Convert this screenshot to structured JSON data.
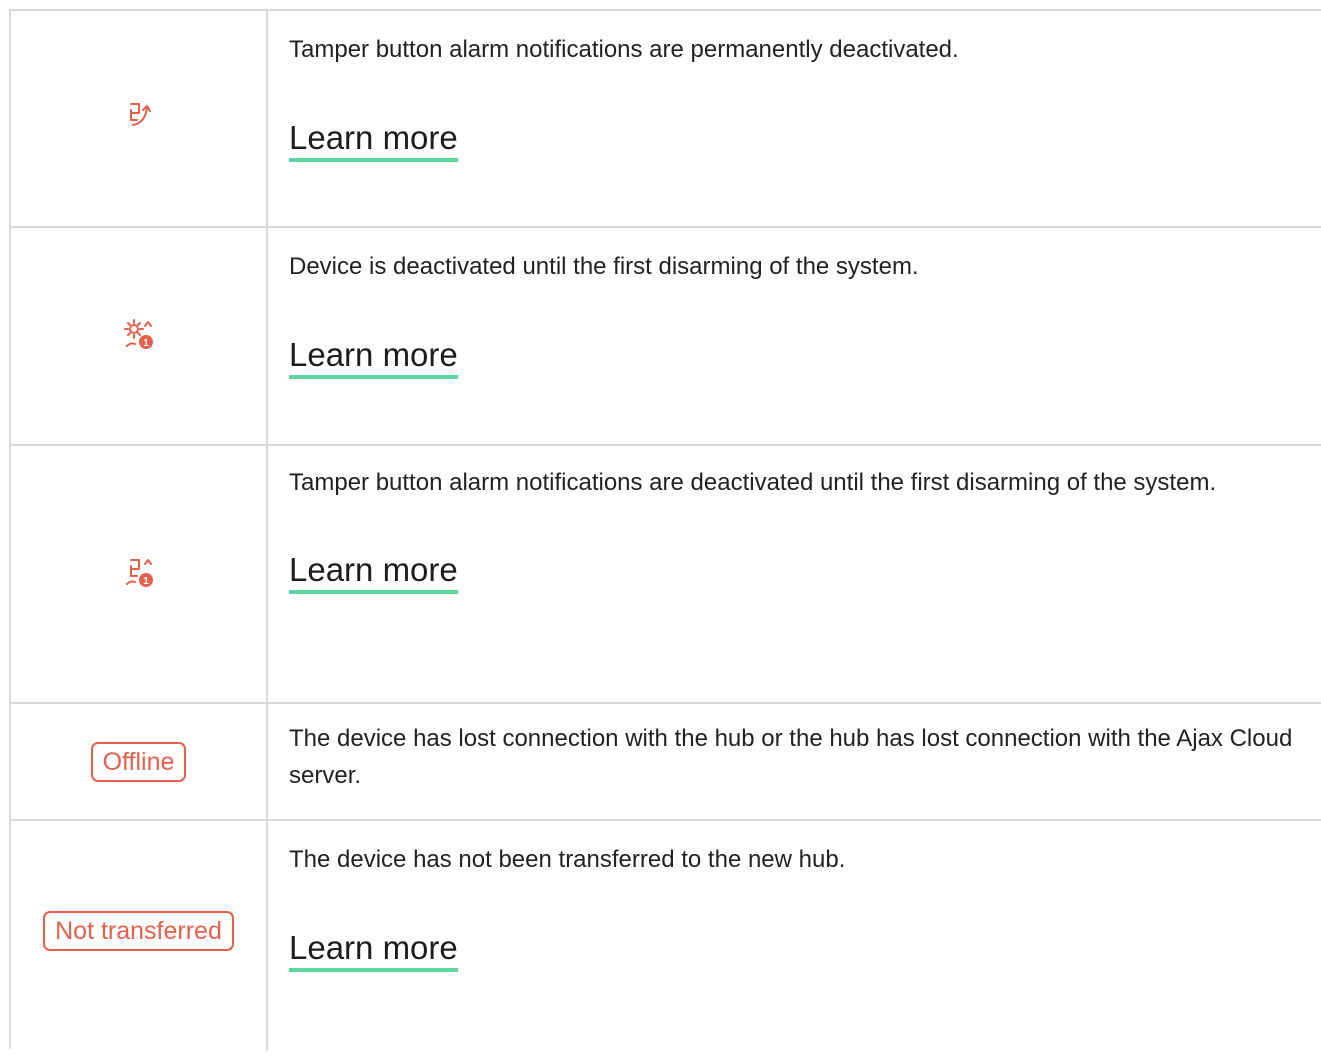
{
  "colors": {
    "accent": "#e8604c",
    "underline": "#5bd8a0",
    "border": "#dadada"
  },
  "rows": [
    {
      "icon": "tamper-deactivated-icon",
      "description": "Tamper button alarm notifications are permanently deactivated.",
      "link": "Learn more"
    },
    {
      "icon": "device-deactivated-until-disarm-icon",
      "description": "Device is deactivated until the first disarming of the system.",
      "link": "Learn more"
    },
    {
      "icon": "tamper-deactivated-until-disarm-icon",
      "description": "Tamper button alarm notifications are deactivated until the first disarming of the system.",
      "link": "Learn more"
    },
    {
      "badge": "Offline",
      "description": "The device has lost connection with the hub or the hub has lost connection with the Ajax Cloud server."
    },
    {
      "badge": "Not transferred",
      "description": "The device has not been transferred to the new hub.",
      "link": "Learn more"
    }
  ]
}
